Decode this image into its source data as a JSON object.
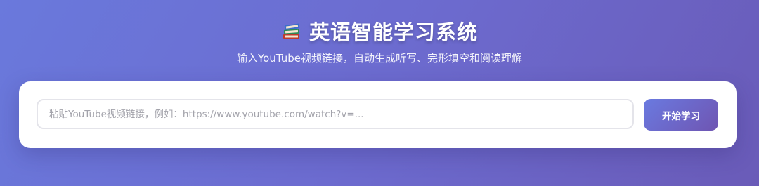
{
  "header": {
    "icon": "books-icon",
    "title": "英语智能学习系统",
    "subtitle": "输入YouTube视频链接，自动生成听写、完形填空和阅读理解"
  },
  "form": {
    "url_input": {
      "value": "",
      "placeholder": "粘贴YouTube视频链接，例如：https://www.youtube.com/watch?v=..."
    },
    "start_button_label": "开始学习"
  },
  "colors": {
    "background_start": "#6a79dc",
    "background_end": "#6a5bb8",
    "button_start": "#6a7ae0",
    "button_end": "#6f55b2",
    "card": "#ffffff"
  }
}
